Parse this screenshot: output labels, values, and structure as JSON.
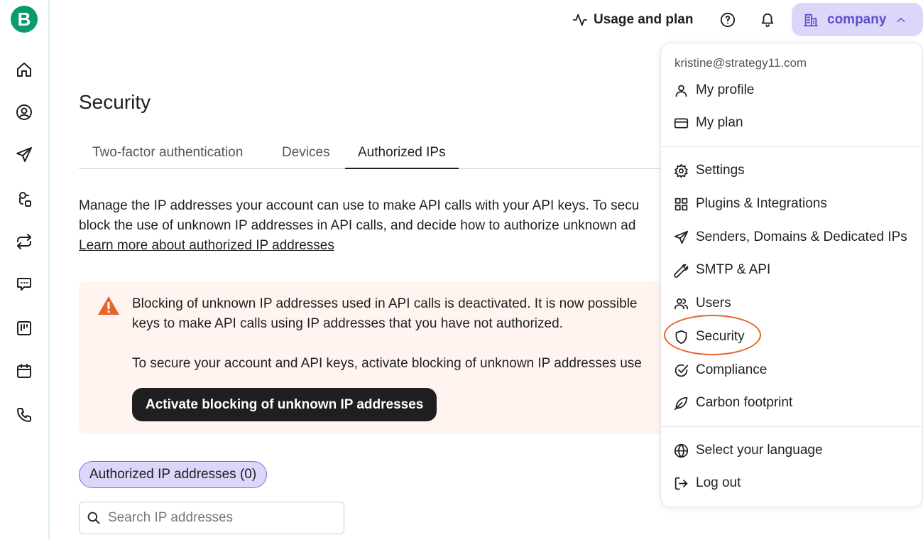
{
  "sidebar": {
    "logo_letter": "B",
    "items": [
      {
        "name": "home-icon"
      },
      {
        "name": "contacts-icon"
      },
      {
        "name": "campaigns-icon"
      },
      {
        "name": "automations-icon"
      },
      {
        "name": "transactional-icon"
      },
      {
        "name": "conversations-icon"
      },
      {
        "name": "crm-icon"
      },
      {
        "name": "meetings-icon"
      },
      {
        "name": "phone-icon"
      }
    ]
  },
  "topbar": {
    "usage_label": "Usage and plan",
    "company_label": "company"
  },
  "page": {
    "title": "Security",
    "tabs": [
      {
        "label": "Two-factor authentication",
        "active": false
      },
      {
        "label": "Devices",
        "active": false
      },
      {
        "label": "Authorized IPs",
        "active": true
      }
    ],
    "description_line1": "Manage the IP addresses your account can use to make API calls with your API keys. To secu",
    "description_line2": "block the use of unknown IP addresses in API calls, and decide how to authorize unknown ad",
    "learn_more_link": "Learn more about authorized IP addresses"
  },
  "alert": {
    "line1": "Blocking of unknown IP addresses used in API calls is deactivated. It is now possible",
    "line2": "keys to make API calls using IP addresses that you have not authorized.",
    "line3": "To secure your account and API keys, activate blocking of unknown IP addresses use",
    "button_label": "Activate blocking of unknown IP addresses",
    "color": "#e8632b"
  },
  "ip_list": {
    "chip_label": "Authorized IP addresses (0)",
    "search_placeholder": "Search IP addresses"
  },
  "dropdown": {
    "email": "kristine@strategy11.com",
    "items": [
      {
        "label": "My profile",
        "icon": "user-icon"
      },
      {
        "label": "My plan",
        "icon": "credit-card-icon"
      },
      {
        "label": "Settings",
        "icon": "gear-icon"
      },
      {
        "label": "Plugins & Integrations",
        "icon": "grid-icon"
      },
      {
        "label": "Senders, Domains & Dedicated IPs",
        "icon": "send-icon"
      },
      {
        "label": "SMTP & API",
        "icon": "wrench-icon"
      },
      {
        "label": "Users",
        "icon": "users-icon"
      },
      {
        "label": "Security",
        "icon": "shield-icon",
        "highlighted": true
      },
      {
        "label": "Compliance",
        "icon": "check-circle-icon"
      },
      {
        "label": "Carbon footprint",
        "icon": "leaf-icon"
      },
      {
        "label": "Select your language",
        "icon": "globe-icon"
      },
      {
        "label": "Log out",
        "icon": "logout-icon"
      }
    ]
  },
  "colors": {
    "brand_green": "#0b996e",
    "accent_purple": "#5a4fcf",
    "chip_purple": "#dcd6fb",
    "highlight_orange": "#e8632b"
  }
}
